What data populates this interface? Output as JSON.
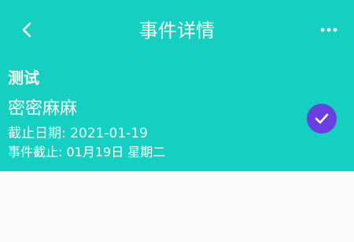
{
  "header": {
    "title": "事件详情",
    "back_icon": "chevron-left-icon",
    "more_icon": "more-horizontal-icon"
  },
  "event": {
    "group": "测试",
    "name": "密密麻麻",
    "deadline_text": "截止日期: 2021-01-19",
    "event_deadline_text": "事件截止: 01月19日 星期二",
    "completed": true,
    "status_icon": "check-icon"
  },
  "colors": {
    "header_bg": "#15cfc1",
    "check_bg": "#6a3fe0",
    "page_bg": "#fafafa"
  }
}
